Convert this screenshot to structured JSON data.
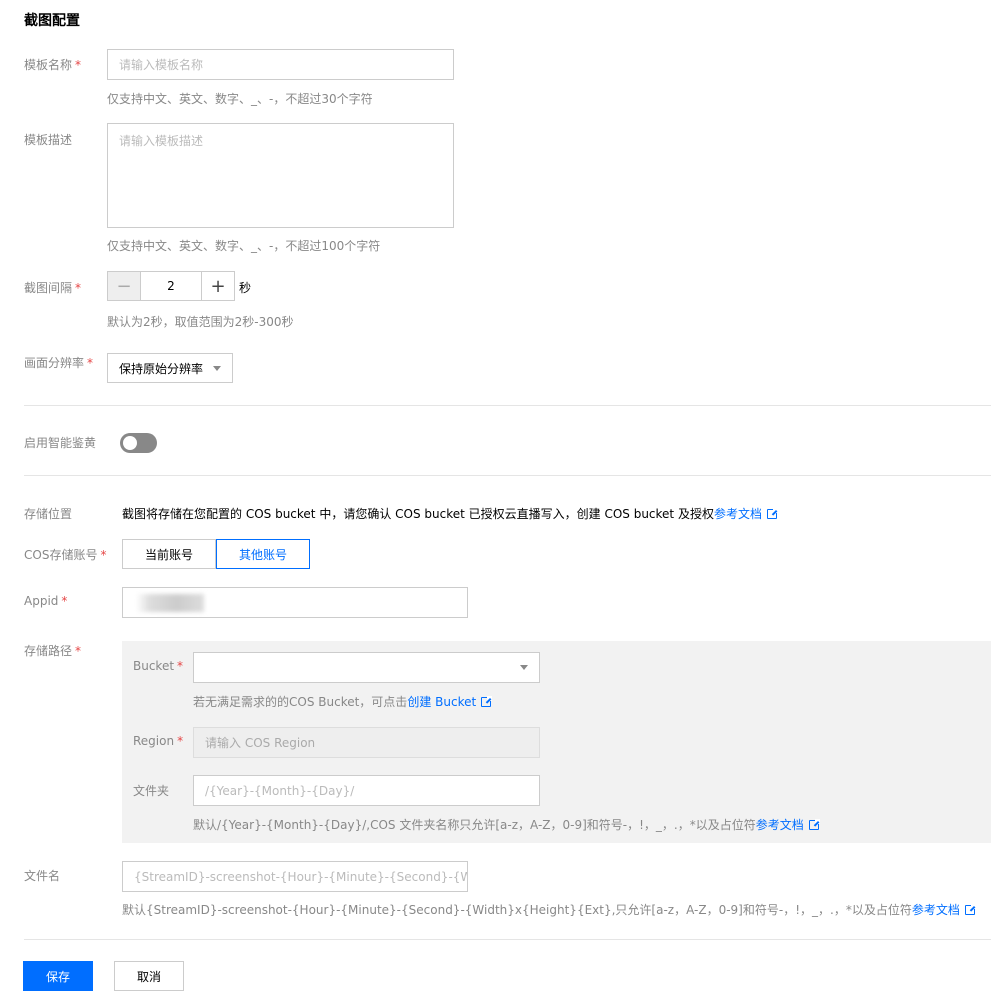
{
  "page_title": "截图配置",
  "template_name": {
    "label": "模板名称",
    "required_mark": "*",
    "placeholder": "请输入模板名称",
    "hint": "仅支持中文、英文、数字、_、-，不超过30个字符"
  },
  "template_desc": {
    "label": "模板描述",
    "placeholder": "请输入模板描述",
    "hint": "仅支持中文、英文、数字、_、-，不超过100个字符"
  },
  "interval": {
    "label": "截图间隔",
    "required_mark": "*",
    "minus": "−",
    "value": "2",
    "plus": "+",
    "unit": "秒",
    "hint": "默认为2秒，取值范围为2秒-300秒"
  },
  "resolution": {
    "label": "画面分辨率",
    "required_mark": "*",
    "selected": "保持原始分辨率"
  },
  "smart_review": {
    "label": "启用智能鉴黄",
    "enabled": false
  },
  "storage_location": {
    "label": "存储位置",
    "text": "截图将存储在您配置的 COS bucket 中，请您确认 COS bucket 已授权云直播写入，创建 COS bucket 及授权",
    "link": "参考文档"
  },
  "cos_account": {
    "label": "COS存储账号",
    "required_mark": "*",
    "options": [
      "当前账号",
      "其他账号"
    ],
    "selected_index": 1
  },
  "appid": {
    "label": "Appid",
    "required_mark": "*"
  },
  "storage_path": {
    "label": "存储路径",
    "required_mark": "*",
    "bucket_label": "Bucket",
    "bucket_hint": "若无满足需求的的COS Bucket，可点击",
    "bucket_link": "创建 Bucket",
    "region_label": "Region",
    "region_placeholder": "请输入 COS Region",
    "folder_label": "文件夹",
    "folder_placeholder": "/{Year}-{Month}-{Day}/",
    "folder_hint": "默认/{Year}-{Month}-{Day}/,COS 文件夹名称只允许[a-z，A-Z，0-9]和符号-，!，_，.，*以及占位符",
    "folder_link": "参考文档"
  },
  "file_name": {
    "label": "文件名",
    "placeholder": "{StreamID}-screenshot-{Hour}-{Minute}-{Second}-{Width}x",
    "hint": "默认{StreamID}-screenshot-{Hour}-{Minute}-{Second}-{Width}x{Height}{Ext},只允许[a-z，A-Z，0-9]和符号-，!，_，.，*以及占位符",
    "link": "参考文档"
  },
  "actions": {
    "save": "保存",
    "cancel": "取消"
  },
  "colors": {
    "primary": "#006eff",
    "required": "#e54545",
    "panel_bg": "#f2f2f2"
  }
}
